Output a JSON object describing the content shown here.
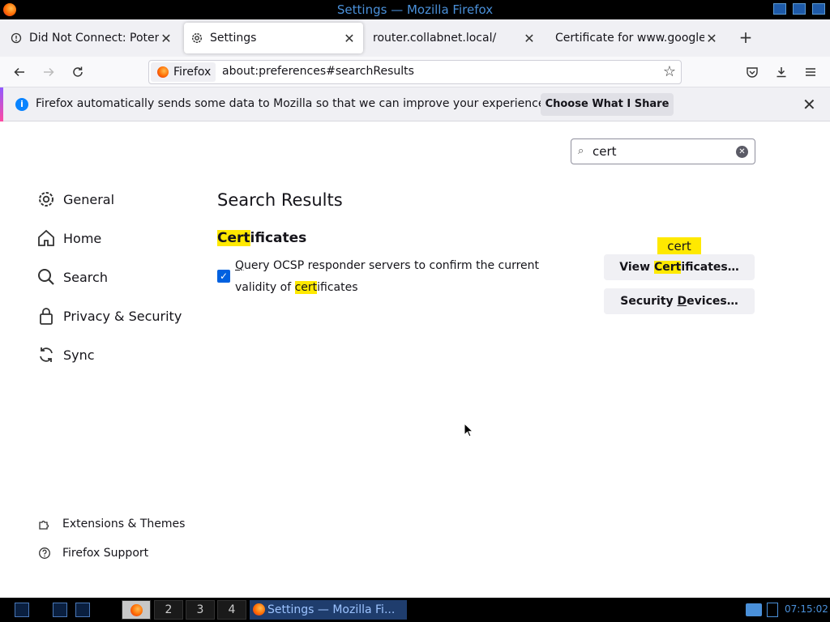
{
  "window": {
    "title": "Settings — Mozilla Firefox"
  },
  "tabs": [
    {
      "label": "Did Not Connect: Potenti",
      "icon": "warning-icon",
      "active": false
    },
    {
      "label": "Settings",
      "icon": "gear-icon",
      "active": true
    },
    {
      "label": "router.collabnet.local/",
      "icon": "",
      "active": false
    },
    {
      "label": "Certificate for www.google.c",
      "icon": "",
      "active": false
    }
  ],
  "navbar": {
    "identity_label": "Firefox",
    "url": "about:preferences#searchResults"
  },
  "notification": {
    "message": "Firefox automatically sends some data to Mozilla so that we can improve your experience.",
    "button_label": "Choose What I Share"
  },
  "search": {
    "value": "cert"
  },
  "sidebar": {
    "categories": [
      {
        "label": "General",
        "icon": "gear-icon"
      },
      {
        "label": "Home",
        "icon": "home-icon"
      },
      {
        "label": "Search",
        "icon": "search-icon"
      },
      {
        "label": "Privacy & Security",
        "icon": "lock-icon"
      },
      {
        "label": "Sync",
        "icon": "sync-icon"
      }
    ],
    "footer": [
      {
        "label": "Extensions & Themes",
        "icon": "puzzle-icon"
      },
      {
        "label": "Firefox Support",
        "icon": "help-icon"
      }
    ]
  },
  "main": {
    "title": "Search Results",
    "section": {
      "heading_highlight": "Cert",
      "heading_rest": "ificates",
      "checkbox_checked": true,
      "checkbox_label_1": "uery OCSP responder servers to confirm the current",
      "checkbox_label_1_accesskey": "Q",
      "checkbox_label_2_prefix": "validity of ",
      "checkbox_label_2_highlight": "cert",
      "checkbox_label_2_suffix": "ificates",
      "tooltip": "cert",
      "view_button_prefix": "View ",
      "view_button_highlight": "Cert",
      "view_button_suffix": "ificates…",
      "devices_button_prefix": "Security ",
      "devices_button_accesskey": "D",
      "devices_button_suffix": "evices…"
    }
  },
  "taskbar": {
    "workspaces": [
      "2",
      "3",
      "4"
    ],
    "window_label": "Settings — Mozilla Fi...",
    "clock": "07:15:02"
  },
  "colors": {
    "highlight": "#ffe900",
    "accent_blue": "#0061e0",
    "titlebar_text": "#4a90d9"
  }
}
